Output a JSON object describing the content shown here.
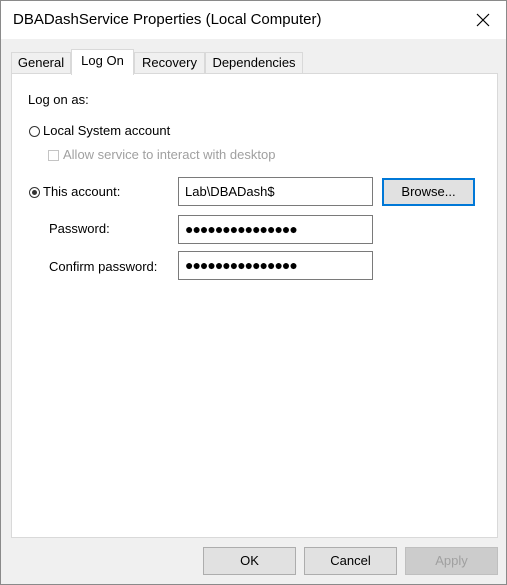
{
  "window": {
    "title": "DBADashService Properties (Local Computer)"
  },
  "tabs": [
    {
      "label": "General"
    },
    {
      "label": "Log On"
    },
    {
      "label": "Recovery"
    },
    {
      "label": "Dependencies"
    }
  ],
  "active_tab": "Log On",
  "logon": {
    "section_label": "Log on as:",
    "local_system_label": "Local System account",
    "interact_desktop_label": "Allow service to interact with desktop",
    "this_account_label": "This account:",
    "account_value": "Lab\\DBADash$",
    "browse_label": "Browse...",
    "password_label": "Password:",
    "password_value": "●●●●●●●●●●●●●●●",
    "confirm_label": "Confirm password:",
    "confirm_value": "●●●●●●●●●●●●●●●",
    "selected_option": "This account:"
  },
  "footer": {
    "ok_label": "OK",
    "cancel_label": "Cancel",
    "apply_label": "Apply"
  },
  "colors": {
    "focus_border": "#0078d7",
    "dialog_bg": "#f0f0f0"
  }
}
